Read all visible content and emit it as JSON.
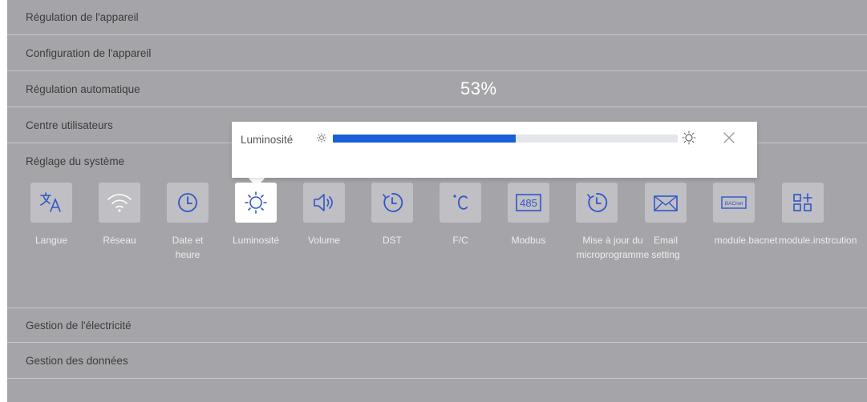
{
  "menu": {
    "device_regulation": "Régulation de l'appareil",
    "device_configuration": "Configuration de l'appareil",
    "auto_regulation": "Régulation automatique",
    "user_center": "Centre utilisateurs",
    "system_settings": "Réglage du système",
    "power_management": "Gestion de l'électricité",
    "data_management": "Gestion des données"
  },
  "overlay_percent": "53%",
  "system_items": [
    {
      "label": "Langue",
      "icon": "language-icon"
    },
    {
      "label": "Réseau",
      "icon": "wifi-icon"
    },
    {
      "label": "Date et heure",
      "icon": "clock-icon"
    },
    {
      "label": "Luminosité",
      "icon": "sun-icon",
      "active": true
    },
    {
      "label": "Volume",
      "icon": "speaker-icon"
    },
    {
      "label": "DST",
      "icon": "dst-clock-icon"
    },
    {
      "label": "F/C",
      "icon": "celsius-icon"
    },
    {
      "label": "Modbus",
      "icon": "modbus-485-icon",
      "icon_text": "485"
    },
    {
      "label": "Mise à jour du microprogramme",
      "icon": "firmware-update-icon"
    },
    {
      "label": "Email setting",
      "icon": "envelope-icon"
    },
    {
      "label": "module.bacnet",
      "icon": "bacnet-icon",
      "icon_text": "BACnet"
    },
    {
      "label": "module.instrcution",
      "icon": "add-module-icon"
    }
  ],
  "brightness_popup": {
    "title": "Luminosité",
    "value_percent": 53,
    "min_icon": "sun-small-icon",
    "max_icon": "sun-large-icon",
    "close_icon": "close-icon"
  },
  "colors": {
    "background": "#a5a5a9",
    "tile": "#bfbfc4",
    "accent": "#1a60d8",
    "active_tile": "#ffffff"
  }
}
